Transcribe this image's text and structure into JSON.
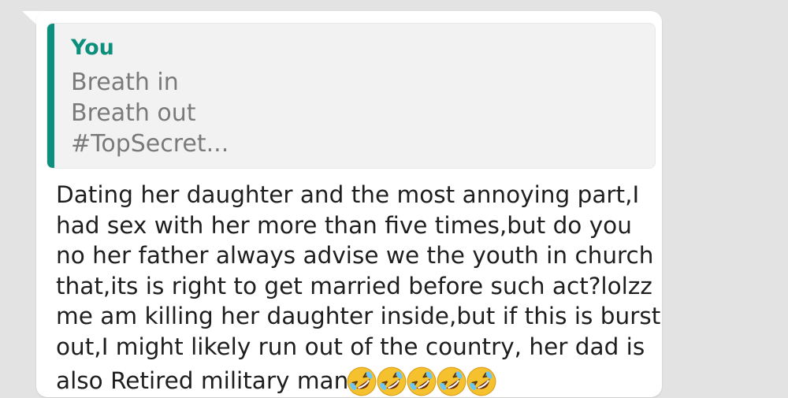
{
  "quoted_reply": {
    "author": "You",
    "lines": [
      "Breath in",
      "Breath out",
      "#TopSecret..."
    ]
  },
  "message": {
    "lines": [
      "Dating her daughter and the most annoying part,I",
      "had sex with her more than five times,but do you",
      "no her father always advise we the youth in church",
      "that,its is right to get married before such act?lolzz",
      "me am killing her daughter inside,but if this is burst",
      "out,I might likely run out of the country, her dad is",
      "also Retired military man"
    ],
    "emoji": [
      "rolling-on-floor-laughing",
      "rolling-on-floor-laughing",
      "rolling-on-floor-laughing",
      "rolling-on-floor-laughing",
      "rolling-on-floor-laughing"
    ]
  },
  "colors": {
    "background": "#e3e3e3",
    "bubble": "#ffffff",
    "quote_background": "#f2f2f2",
    "accent": "#0c8f7c",
    "quote_text": "#7a7a7a",
    "message_text": "#1e1e1e",
    "emoji_face": "#f6c12e"
  }
}
